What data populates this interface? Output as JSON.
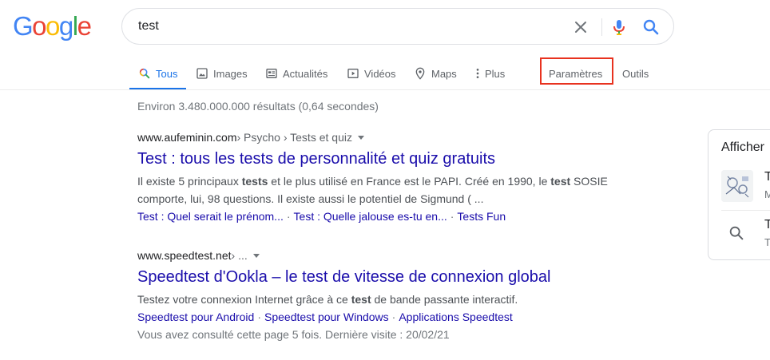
{
  "logo": {
    "letters": [
      "G",
      "o",
      "o",
      "g",
      "l",
      "e"
    ],
    "colors": [
      "#4285F4",
      "#EA4335",
      "#FBBC05",
      "#4285F4",
      "#34A853",
      "#EA4335"
    ]
  },
  "search": {
    "value": "test"
  },
  "tabs": [
    {
      "label": "Tous",
      "icon": "search-icon",
      "active": true
    },
    {
      "label": "Images",
      "icon": "image-icon"
    },
    {
      "label": "Actualités",
      "icon": "news-icon"
    },
    {
      "label": "Vidéos",
      "icon": "video-icon"
    },
    {
      "label": "Maps",
      "icon": "map-pin-icon"
    },
    {
      "label": "Plus",
      "icon": "more-vert-icon"
    },
    {
      "label": "Paramètres"
    },
    {
      "label": "Outils"
    }
  ],
  "stats": "Environ 3.480.000.000 résultats (0,64 secondes)",
  "results": [
    {
      "domain": "www.aufeminin.com",
      "breadcrumb": " › Psycho › Tests et quiz",
      "title": "Test : tous les tests de personnalité et quiz gratuits",
      "snippet_line1_a": "Il existe 5 principaux ",
      "snippet_line1_b": "tests",
      "snippet_line1_c": " et le plus utilisé en France est le PAPI. Créé en 1990, le ",
      "snippet_line1_d": "test",
      "snippet_line1_e": " SOSIE",
      "snippet_line2": "comporte, lui, 98 questions. Il existe aussi le potentiel de Sigmund ( ...",
      "sitelinks": [
        "Test : Quel serait le prénom...",
        "Test : Quelle jalouse es-tu en...",
        "Tests Fun"
      ]
    },
    {
      "domain": "www.speedtest.net",
      "breadcrumb": " › ...",
      "title": "Speedtest d'Ookla – le test de vitesse de connexion global",
      "snippet_a": "Testez votre connexion Internet grâce à ce ",
      "snippet_b": "test",
      "snippet_c": " de bande passante interactif.",
      "sitelinks": [
        "Speedtest pour Android",
        "Speedtest pour Windows",
        "Applications Speedtest"
      ],
      "visited": "Vous avez consulté cette page 5 fois. Dernière visite : 20/02/21"
    }
  ],
  "side_panel": {
    "title": "Afficher",
    "item1_text": "T",
    "item1_sub": "M",
    "item2_text": "T",
    "item2_sub": "T"
  },
  "colors": {
    "link": "#1a0dab",
    "accent": "#1a73e8",
    "highlight": "#e8321f"
  }
}
